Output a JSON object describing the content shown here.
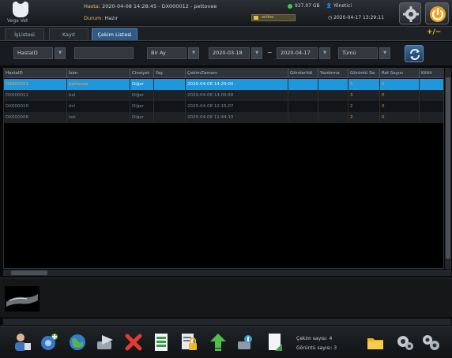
{
  "app": {
    "logo_text": "Vega Vet"
  },
  "header": {
    "patient_key": "Hasta:",
    "patient_value": "2020-04-08 14:28:45 - DX000012 - pettovee",
    "status_key": "Durum:",
    "status_value": "Hazır",
    "disk_text": "927.07 GB",
    "user_text": "Yönetici",
    "online_text": "online",
    "datetime": "2020-04-17 13:29:11"
  },
  "tabs": [
    {
      "label": "İşListesi",
      "active": false
    },
    {
      "label": "Kayıt",
      "active": false
    },
    {
      "label": "Çekim Listesi",
      "active": true
    }
  ],
  "plusminus_label": "+/−",
  "filters": {
    "field_label": "HastaID",
    "search_value": "",
    "period_label": "Bir Ay",
    "date_from": "2020-03-18",
    "date_to": "2020-04-17",
    "separator": "~",
    "scope_label": "Tümü"
  },
  "table": {
    "columns": [
      "HastaID",
      "İsim",
      "Cinsiyet",
      "Yaş",
      "ÇekimZamanı",
      "Gönderildi",
      "Yazdırma",
      "Görüntü Sa",
      "Ret Sayısı",
      "Kilitli"
    ],
    "rows": [
      {
        "id": "DX000012",
        "name": "pettovee",
        "gender": "Diğer",
        "age": "",
        "time": "2020-04-08 14:29:00",
        "sent": "",
        "print": "",
        "images": "3",
        "rejects": "0",
        "locked": "",
        "selected": true
      },
      {
        "id": "DX000011",
        "name": "bal",
        "gender": "Diğer",
        "age": "",
        "time": "2020-04-08 14:09:58",
        "sent": "",
        "print": "",
        "images": "3",
        "rejects": "0",
        "locked": "",
        "selected": false
      },
      {
        "id": "DX000010",
        "name": "öcl",
        "gender": "Diğer",
        "age": "",
        "time": "2020-04-08 12:15:07",
        "sent": "",
        "print": "",
        "images": "2",
        "rejects": "0",
        "locked": "",
        "selected": false
      },
      {
        "id": "DX000008",
        "name": "tek",
        "gender": "Diğer",
        "age": "",
        "time": "2020-04-08 11:44:10",
        "sent": "",
        "print": "",
        "images": "2",
        "rejects": "0",
        "locked": "",
        "selected": false
      }
    ]
  },
  "footer": {
    "capture_count": "Çekim sayısı: 4",
    "image_count": "Görüntü sayısı: 3"
  },
  "toolbar_icons": [
    "patient-icon",
    "add-capture-icon",
    "globe-icon",
    "send-icon",
    "delete-icon",
    "document-icon",
    "lock-document-icon",
    "upload-icon",
    "tools-icon",
    "export-icon",
    "folder-icon",
    "settings-cart-icon",
    "settings-icon"
  ],
  "colors": {
    "accent": "#1f97dc",
    "active_tab": "#2f5b86",
    "warning": "#f0c419"
  }
}
